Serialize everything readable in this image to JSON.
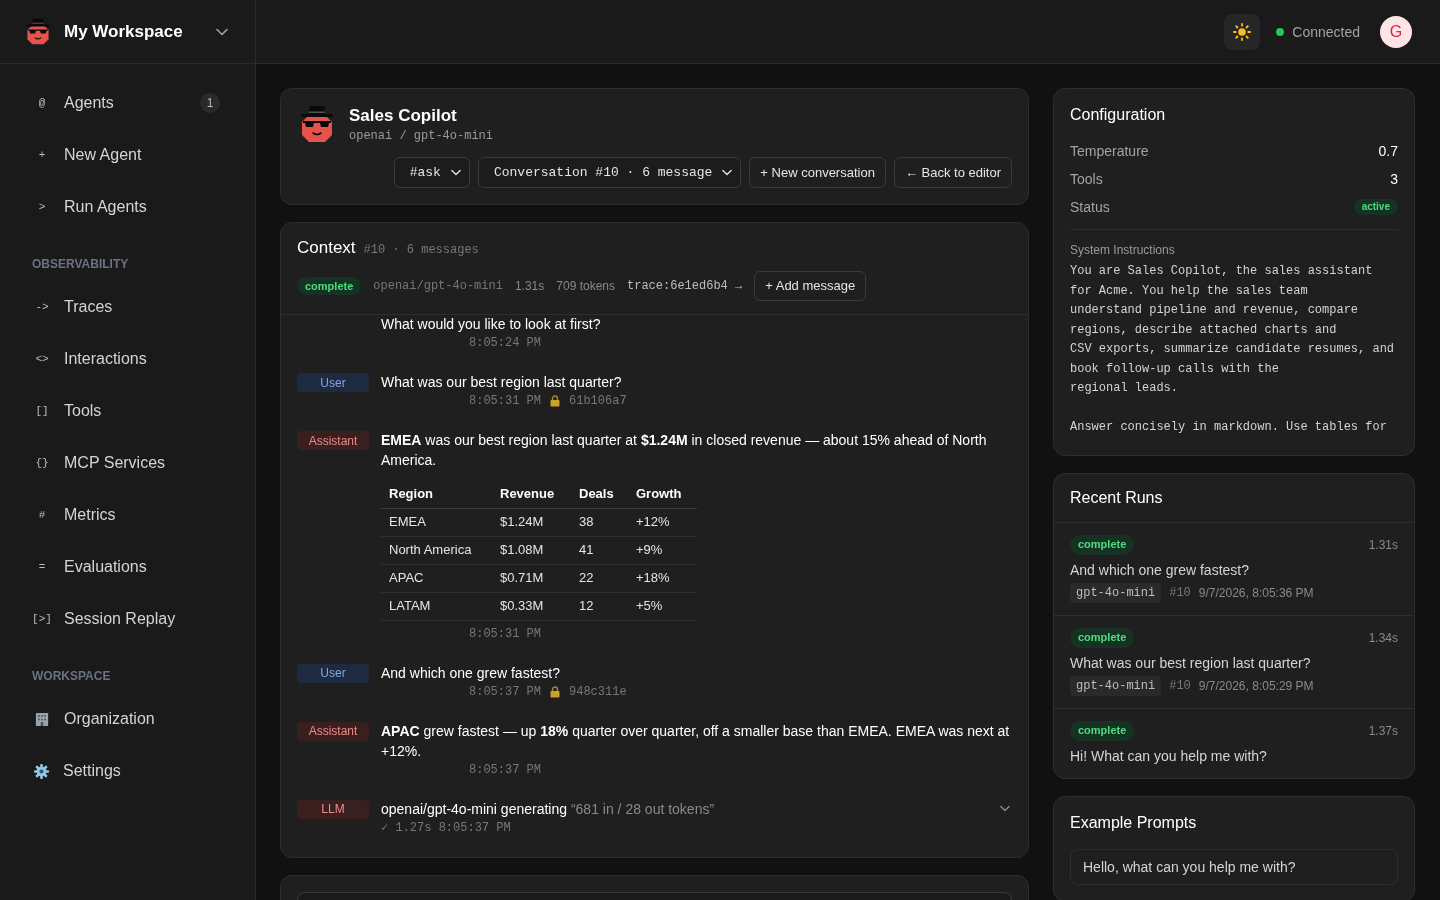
{
  "sidebar": {
    "workspace": "My Workspace",
    "sections": [
      {
        "items": [
          {
            "kind": "glyph",
            "icon": "@",
            "label": "Agents",
            "badge": "1",
            "selected": false
          },
          {
            "kind": "glyph",
            "icon": "+",
            "label": "New Agent",
            "selected": false
          },
          {
            "kind": "glyph",
            "icon": ">",
            "label": "Run Agents",
            "selected": false
          }
        ]
      },
      {
        "title": "OBSERVABILITY",
        "items": [
          {
            "kind": "glyph",
            "icon": "->",
            "label": "Traces",
            "selected": false
          },
          {
            "kind": "glyph",
            "icon": "<>",
            "label": "Interactions",
            "selected": false
          },
          {
            "kind": "glyph",
            "icon": "[]",
            "label": "Tools",
            "selected": false
          },
          {
            "kind": "glyph",
            "icon": "{}",
            "label": "MCP Services",
            "selected": false
          },
          {
            "kind": "glyph",
            "icon": "#",
            "label": "Metrics",
            "selected": false
          },
          {
            "kind": "glyph",
            "icon": "=",
            "label": "Evaluations",
            "selected": false
          },
          {
            "kind": "glyph",
            "icon": "[>]",
            "label": "Session Replay",
            "selected": false
          }
        ]
      },
      {
        "title": "WORKSPACE",
        "items": [
          {
            "kind": "building",
            "label": "Organization",
            "selected": false
          },
          {
            "kind": "gear",
            "label": "Settings",
            "selected": false
          }
        ]
      }
    ]
  },
  "header": {
    "connection": "Connected",
    "connected": true,
    "avatar": "G"
  },
  "agent": {
    "name": "Sales Copilot",
    "model": "openai / gpt-4o-mini",
    "selects": [
      "#ask",
      "Conversation #10 · 6 message"
    ],
    "buttons": [
      "+ New conversation",
      "← Back to editor"
    ]
  },
  "context": {
    "title": "Context",
    "subtitle": "#10 · 6 messages",
    "status": "complete",
    "model": "openai/gpt-4o-mini",
    "duration": "1.31s",
    "tokens": "709 tokens",
    "trace": "trace:6e1ed6b4 →",
    "add_button": "+ Add message",
    "messages": [
      {
        "text": "What would you like to look at first?",
        "time": "8:05:24 PM"
      },
      {
        "kind": "user",
        "role": "User",
        "text": "What was our best region last quarter?",
        "time": "8:05:31 PM",
        "hash": "61b106a7"
      },
      {
        "kind": "assistant",
        "role": "Assistant",
        "text": "**EMEA** was our best region last quarter at **$1.24M** in closed revenue — about 15% ahead of North America.",
        "table": {
          "columns": [
            "Region",
            "Revenue",
            "Deals",
            "Growth"
          ],
          "rows": [
            [
              "EMEA",
              "$1.24M",
              "38",
              "+12%"
            ],
            [
              "North America",
              "$1.08M",
              "41",
              "+9%"
            ],
            [
              "APAC",
              "$0.71M",
              "22",
              "+18%"
            ],
            [
              "LATAM",
              "$0.33M",
              "12",
              "+5%"
            ]
          ]
        },
        "time": "8:05:31 PM"
      },
      {
        "kind": "user",
        "role": "User",
        "text": "And which one grew fastest?",
        "time": "8:05:37 PM",
        "hash": "948c311e"
      },
      {
        "kind": "assistant",
        "role": "Assistant",
        "text": "**APAC** grew fastest — up **18%** quarter over quarter, off a smaller base than EMEA. EMEA was next at +12%.",
        "time": "8:05:37 PM"
      },
      {
        "kind": "llm",
        "role": "LLM",
        "text": "openai/gpt-4o-mini generating",
        "detail": "“681 in / 28 out tokens”",
        "meta": "✓ 1.27s 8:05:37 PM",
        "expanded": false
      }
    ]
  },
  "configuration": {
    "title": "Configuration",
    "rows": [
      {
        "kind": "text",
        "label": "Temperature",
        "value": "0.7"
      },
      {
        "kind": "text",
        "label": "Tools",
        "value": "3"
      },
      {
        "kind": "badge",
        "label": "Status",
        "value": "active"
      }
    ],
    "instructions_label": "System Instructions",
    "instructions": "You are Sales Copilot, the sales assistant\nfor Acme. You help the sales team\nunderstand pipeline and revenue, compare\nregions, describe attached charts and\nCSV exports, summarize candidate resumes, and\nbook follow-up calls with the\nregional leads.\n\nAnswer concisely in markdown. Use tables for"
  },
  "recent_runs": {
    "title": "Recent Runs",
    "runs": [
      {
        "status": "complete",
        "duration": "1.31s",
        "prompt": "And which one grew fastest?",
        "model": "gpt-4o-mini",
        "conversation": "#10",
        "time": "9/7/2026, 8:05:36 PM"
      },
      {
        "status": "complete",
        "duration": "1.34s",
        "prompt": "What was our best region last quarter?",
        "model": "gpt-4o-mini",
        "conversation": "#10",
        "time": "9/7/2026, 8:05:29 PM"
      },
      {
        "status": "complete",
        "duration": "1.37s",
        "prompt": "Hi! What can you help me with?"
      }
    ]
  },
  "example_prompts": {
    "title": "Example Prompts",
    "prompts": [
      "Hello, what can you help me with?"
    ]
  }
}
